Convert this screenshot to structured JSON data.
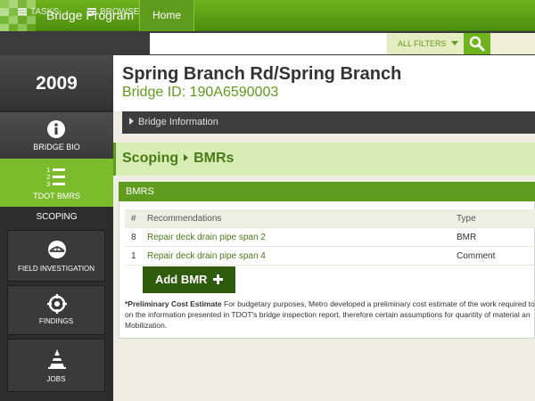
{
  "header": {
    "app_title": "Bridge Program",
    "home_tab": "Home"
  },
  "toolbar": {
    "tasks_label": "TASKS",
    "browse_label": "BROWSE",
    "search_placeholder": "",
    "filters_label": "ALL FILTERS"
  },
  "sidebar": {
    "year": "2009",
    "bio_label": "BRIDGE BIO",
    "bmrs_label": "TDOT BMRS",
    "scoping_label": "SCOPING",
    "sub_items": [
      {
        "label": "FIELD INVESTIGATION"
      },
      {
        "label": "FINDINGS"
      },
      {
        "label": "JOBS"
      }
    ]
  },
  "main": {
    "title": "Spring Branch Rd/Spring Branch",
    "bridge_id": "Bridge ID: 190A6590003",
    "info_bar": "Bridge Information",
    "breadcrumb": {
      "first": "Scoping",
      "second": "BMRs"
    },
    "panel_title": "BMRS",
    "table": {
      "headers": [
        "#",
        "Recommendations",
        "Type"
      ],
      "rows": [
        {
          "num": "8",
          "rec": "Repair deck drain pipe span 2",
          "type": "BMR"
        },
        {
          "num": "1",
          "rec": "Repair deck drain pipe span 4",
          "type": "Comment"
        }
      ]
    },
    "add_button": "Add BMR",
    "note_bold": "*Preliminary Cost Estimate",
    "note_line1": " For budgetary purposes, Metro developed a preliminary cost estimate of the work required to",
    "note_line2": "on the information presented in TDOT's bridge inspection report, therefore certain assumptions for quantity of material an",
    "note_line3": "Mobilization."
  },
  "colors": {
    "brand_green": "#6fb31d",
    "dark_green": "#2f5b0c",
    "sidebar_dark": "#2d2d2d"
  },
  "icons": {
    "tasks": "list-icon",
    "browse": "browse-icon",
    "search": "search-icon",
    "bio": "info-icon",
    "bmrs": "numbered-list-icon",
    "field": "bridge-icon",
    "findings": "target-icon",
    "jobs": "traffic-cone-icon"
  }
}
